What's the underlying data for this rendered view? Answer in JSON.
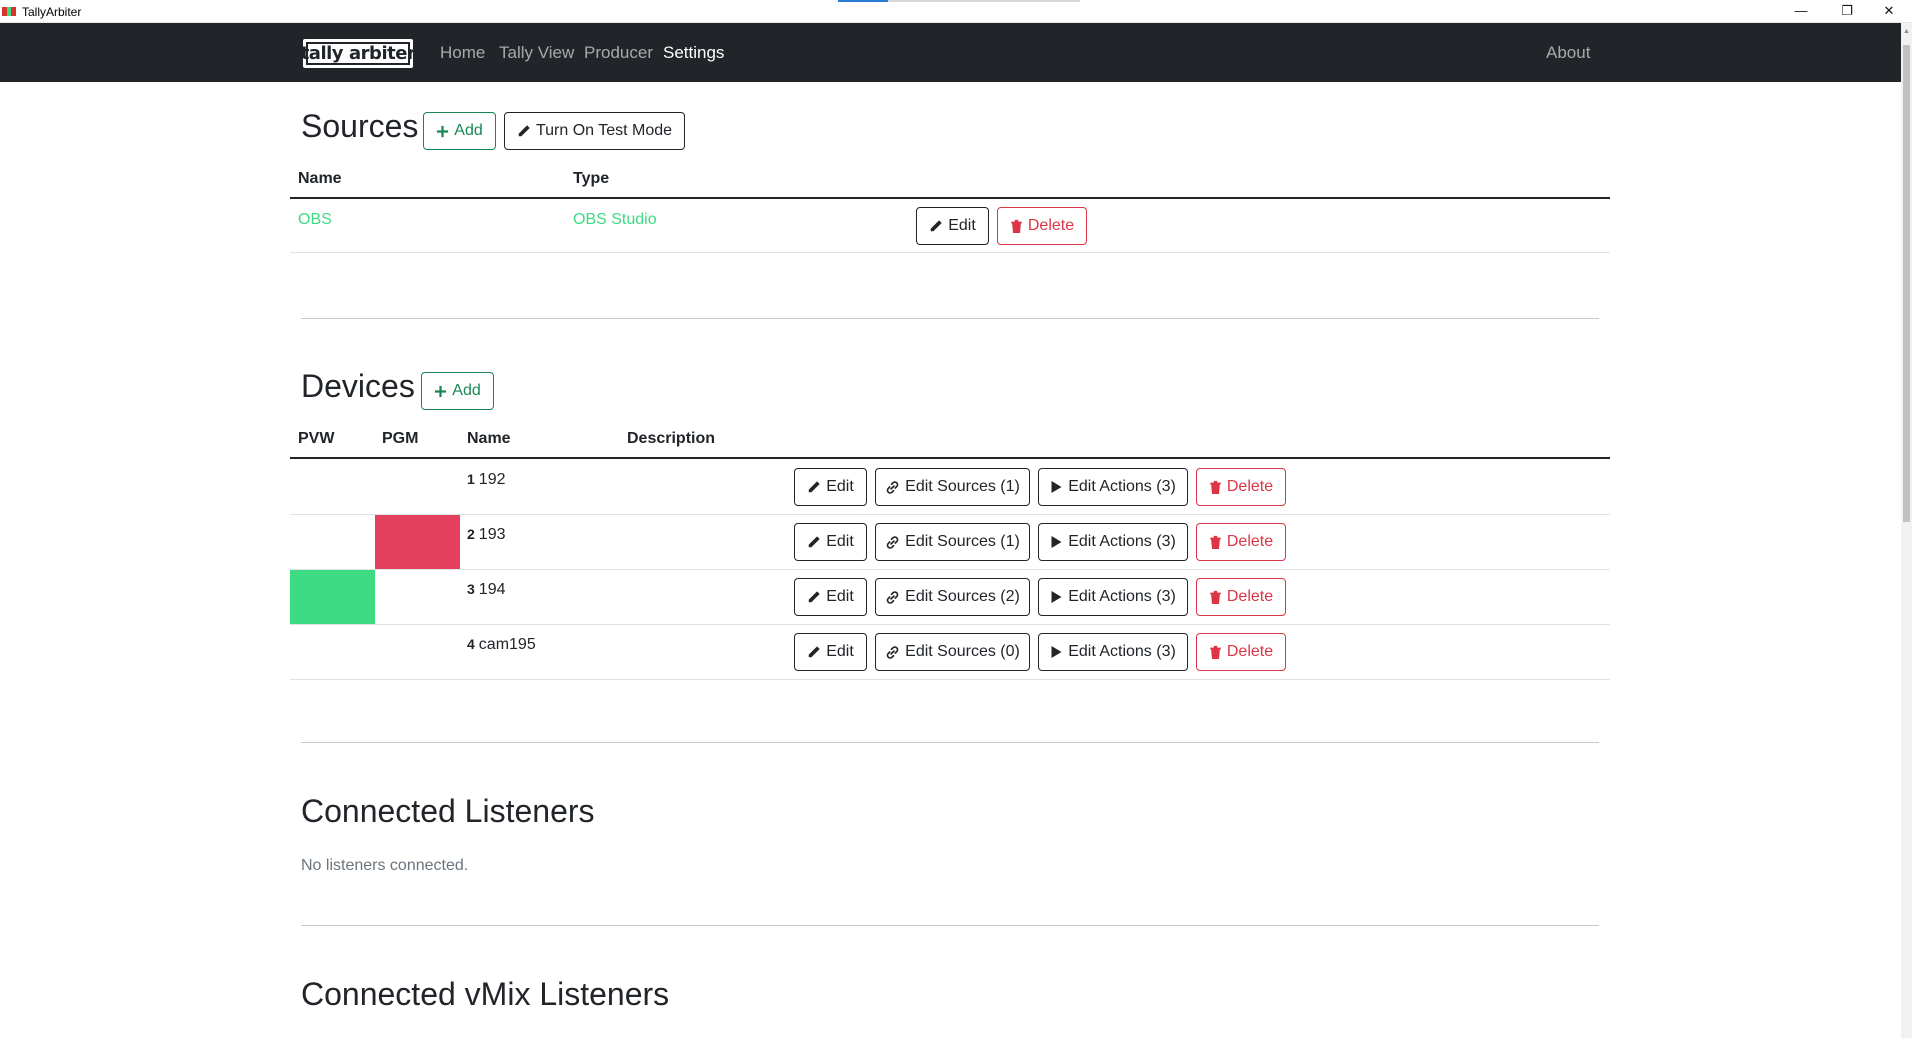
{
  "window": {
    "title": "TallyArbiter",
    "icon_colors": [
      "#d9342b",
      "#3ddc84"
    ]
  },
  "navbar": {
    "brand_left": "tally",
    "brand_right": "arbiter",
    "links": [
      "Home",
      "Tally View",
      "Producer",
      "Settings"
    ],
    "active": "Settings",
    "about": "About"
  },
  "sources": {
    "heading": "Sources",
    "add_label": "Add",
    "test_mode_label": "Turn On Test Mode",
    "columns": [
      "Name",
      "Type"
    ],
    "rows": [
      {
        "name": "OBS",
        "type": "OBS Studio",
        "edit_label": "Edit",
        "delete_label": "Delete"
      }
    ]
  },
  "devices": {
    "heading": "Devices",
    "add_label": "Add",
    "columns": [
      "PVW",
      "PGM",
      "Name",
      "Description"
    ],
    "rows": [
      {
        "id": "1",
        "name": "192",
        "pvw": false,
        "pgm": false,
        "edit": "Edit",
        "sources": "Edit Sources (1)",
        "actions": "Edit Actions (3)",
        "delete": "Delete"
      },
      {
        "id": "2",
        "name": "193",
        "pvw": false,
        "pgm": true,
        "edit": "Edit",
        "sources": "Edit Sources (1)",
        "actions": "Edit Actions (3)",
        "delete": "Delete"
      },
      {
        "id": "3",
        "name": "194",
        "pvw": true,
        "pgm": false,
        "edit": "Edit",
        "sources": "Edit Sources (2)",
        "actions": "Edit Actions (3)",
        "delete": "Delete"
      },
      {
        "id": "4",
        "name": "cam195",
        "pvw": false,
        "pgm": false,
        "edit": "Edit",
        "sources": "Edit Sources (0)",
        "actions": "Edit Actions (3)",
        "delete": "Delete"
      }
    ],
    "colors": {
      "pvw": "#3ddc84",
      "pgm": "#e2405d"
    }
  },
  "listeners": {
    "heading": "Connected Listeners",
    "empty_text": "No listeners connected."
  },
  "vmix": {
    "heading": "Connected vMix Listeners"
  }
}
